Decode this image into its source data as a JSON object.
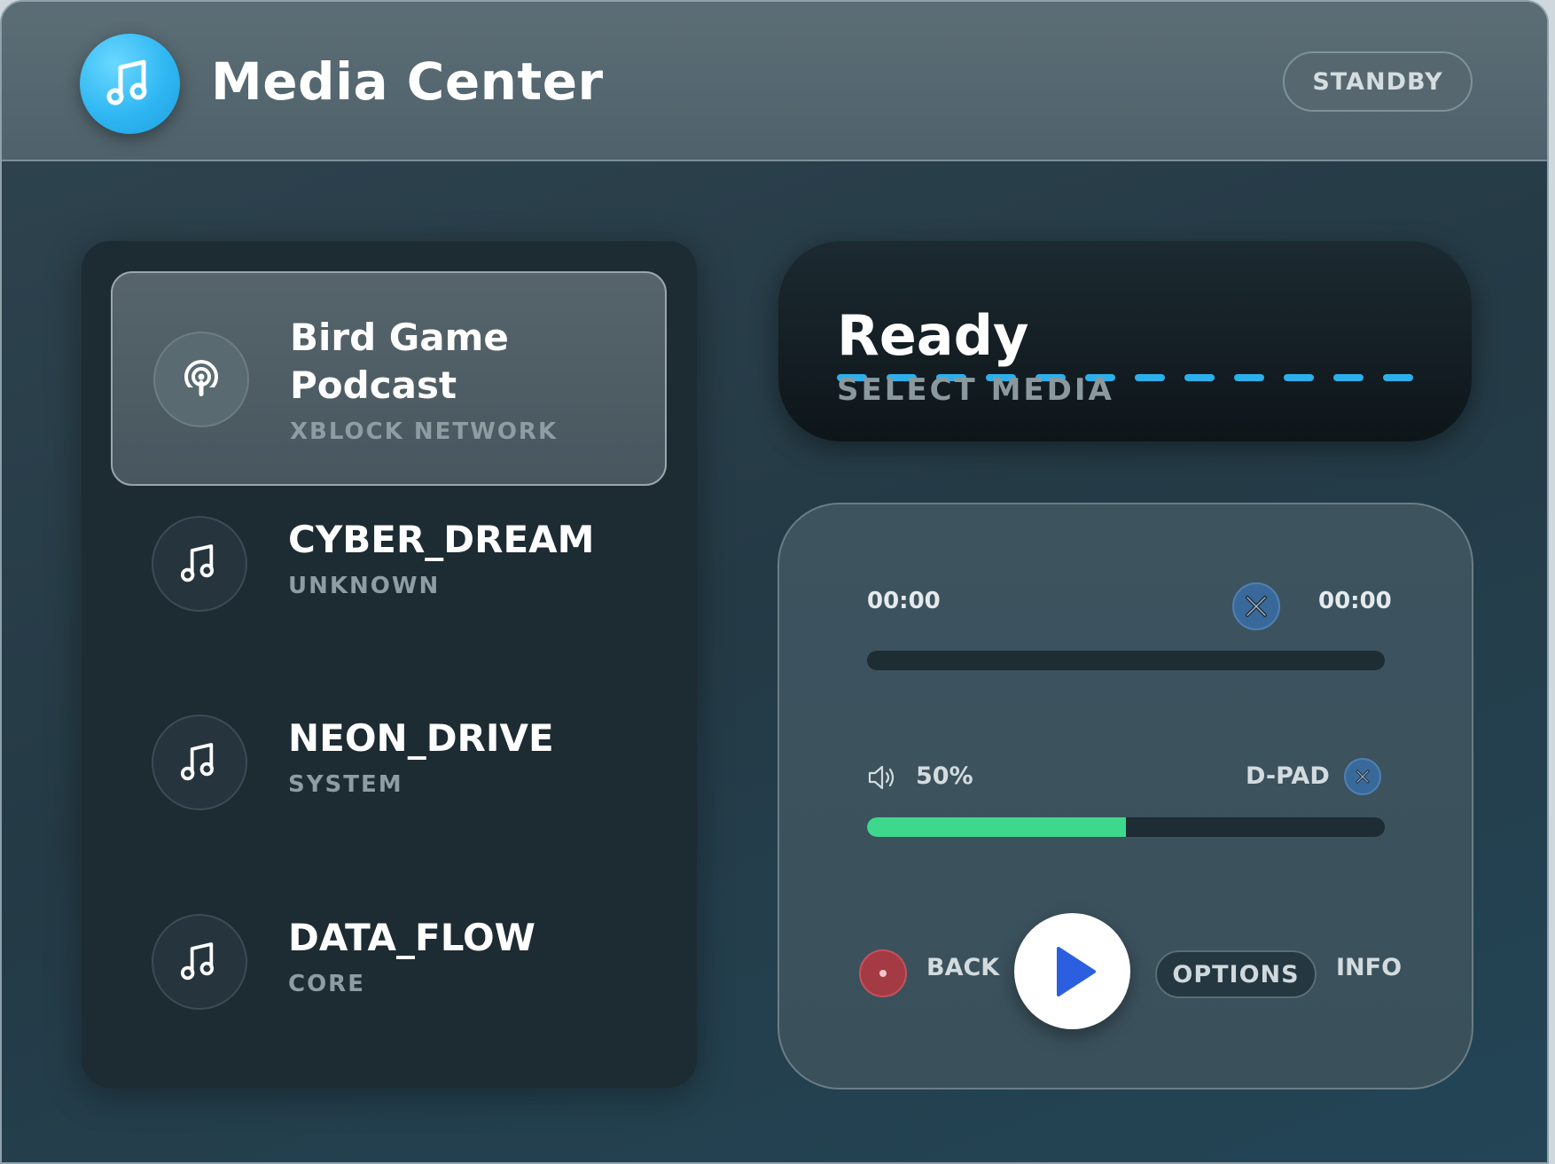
{
  "app": {
    "title": "Media Center",
    "status_button": "STANDBY"
  },
  "playlist": {
    "items": [
      {
        "title": "Bird Game Podcast",
        "subtitle": "XBLOCK NETWORK",
        "icon": "podcast-icon",
        "active": true
      },
      {
        "title": "CYBER_DREAM",
        "subtitle": "UNKNOWN",
        "icon": "music-note-icon",
        "active": false
      },
      {
        "title": "NEON_DRIVE",
        "subtitle": "SYSTEM",
        "icon": "music-note-icon",
        "active": false
      },
      {
        "title": "DATA_FLOW",
        "subtitle": "CORE",
        "icon": "music-note-icon",
        "active": false
      }
    ]
  },
  "display": {
    "status": "Ready",
    "message": "SELECT MEDIA"
  },
  "controls": {
    "time_elapsed": "00:00",
    "time_total": "00:00",
    "progress_fraction": 0,
    "volume_label": "50%",
    "volume_fraction": 0.5,
    "dpad_label": "D-PAD",
    "back_label": "BACK",
    "options_label": "OPTIONS",
    "info_label": "INFO"
  },
  "colors": {
    "accent_blue": "#2fb7f2",
    "volume_green": "#3ed88d",
    "play_blue": "#2b5fe0",
    "record_red": "#a33a44"
  }
}
